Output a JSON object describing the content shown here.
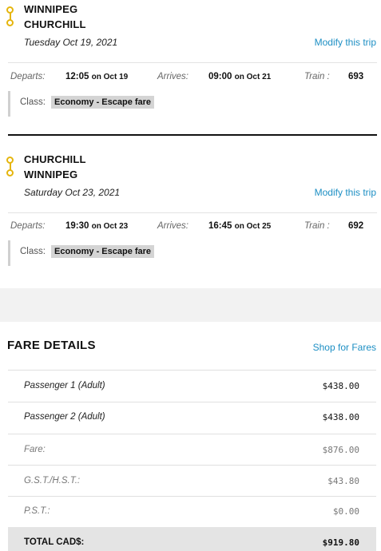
{
  "trips": [
    {
      "origin": "WINNIPEG",
      "destination": "CHURCHILL",
      "date": "Tuesday Oct 19, 2021",
      "modify_label": "Modify this trip",
      "departs_label": "Departs:",
      "departs_time": "12:05",
      "departs_date": "on Oct 19",
      "arrives_label": "Arrives:",
      "arrives_time": "09:00",
      "arrives_date": "on Oct 21",
      "train_label": "Train :",
      "train_number": "693",
      "class_label": "Class:",
      "class_value": "Economy - Escape fare"
    },
    {
      "origin": "CHURCHILL",
      "destination": "WINNIPEG",
      "date": "Saturday Oct 23, 2021",
      "modify_label": "Modify this trip",
      "departs_label": "Departs:",
      "departs_time": "19:30",
      "departs_date": "on Oct 23",
      "arrives_label": "Arrives:",
      "arrives_time": "16:45",
      "arrives_date": "on Oct 25",
      "train_label": "Train :",
      "train_number": "692",
      "class_label": "Class:",
      "class_value": "Economy - Escape fare"
    }
  ],
  "fare_details": {
    "title": "FARE DETAILS",
    "shop_label": "Shop for Fares",
    "rows": [
      {
        "label": "Passenger 1  (Adult)",
        "value": "$438.00"
      },
      {
        "label": "Passenger 2  (Adult)",
        "value": "$438.00"
      },
      {
        "label": "Fare:",
        "value": "$876.00"
      },
      {
        "label": "G.S.T./H.S.T.:",
        "value": "$43.80"
      },
      {
        "label": "P.S.T.:",
        "value": "$0.00"
      }
    ],
    "total_label": "TOTAL CAD$:",
    "total_value": "$919.80"
  },
  "colors": {
    "accent": "#1d8fc4",
    "route_icon": "#e5b50c"
  },
  "icons": [
    "route-icon"
  ]
}
